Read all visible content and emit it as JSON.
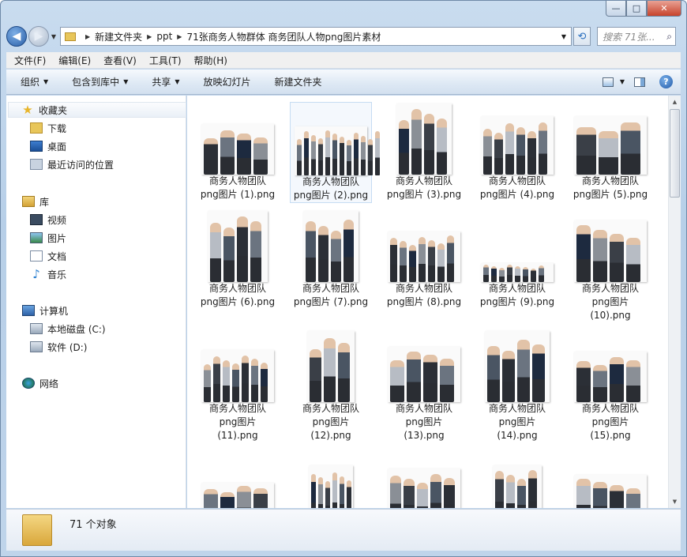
{
  "window": {
    "minimize": "—",
    "maximize": "□",
    "close": "✕"
  },
  "address": {
    "crumbs": [
      "新建文件夹",
      "ppt",
      "71张商务人物群体 商务团队人物png图片素材"
    ],
    "search_placeholder": "搜索 71张..."
  },
  "menu": [
    "文件(F)",
    "编辑(E)",
    "查看(V)",
    "工具(T)",
    "帮助(H)"
  ],
  "toolbar": {
    "organize": "组织",
    "include": "包含到库中",
    "share": "共享",
    "slideshow": "放映幻灯片",
    "new_folder": "新建文件夹"
  },
  "nav": {
    "favorites": "收藏夹",
    "downloads": "下载",
    "desktop": "桌面",
    "recent": "最近访问的位置",
    "libraries": "库",
    "videos": "视频",
    "pictures": "图片",
    "documents": "文档",
    "music": "音乐",
    "computer": "计算机",
    "local_disk": "本地磁盘 (C:)",
    "soft_disk": "软件 (D:)",
    "network": "网络"
  },
  "files": [
    {
      "l1": "商务人物团队",
      "l2": "png图片 (1).png",
      "l3": ""
    },
    {
      "l1": "商务人物团队",
      "l2": "png图片 (2).png",
      "l3": ""
    },
    {
      "l1": "商务人物团队",
      "l2": "png图片 (3).png",
      "l3": ""
    },
    {
      "l1": "商务人物团队",
      "l2": "png图片 (4).png",
      "l3": ""
    },
    {
      "l1": "商务人物团队",
      "l2": "png图片 (5).png",
      "l3": ""
    },
    {
      "l1": "商务人物团队",
      "l2": "png图片 (6).png",
      "l3": ""
    },
    {
      "l1": "商务人物团队",
      "l2": "png图片 (7).png",
      "l3": ""
    },
    {
      "l1": "商务人物团队",
      "l2": "png图片 (8).png",
      "l3": ""
    },
    {
      "l1": "商务人物团队",
      "l2": "png图片 (9).png",
      "l3": ""
    },
    {
      "l1": "商务人物团队",
      "l2": "png图片",
      "l3": "(10).png"
    },
    {
      "l1": "商务人物团队",
      "l2": "png图片",
      "l3": "(11).png"
    },
    {
      "l1": "商务人物团队",
      "l2": "png图片",
      "l3": "(12).png"
    },
    {
      "l1": "商务人物团队",
      "l2": "png图片",
      "l3": "(13).png"
    },
    {
      "l1": "商务人物团队",
      "l2": "png图片",
      "l3": "(14).png"
    },
    {
      "l1": "商务人物团队",
      "l2": "png图片",
      "l3": "(15).png"
    }
  ],
  "status": {
    "count": "71 个对象"
  }
}
